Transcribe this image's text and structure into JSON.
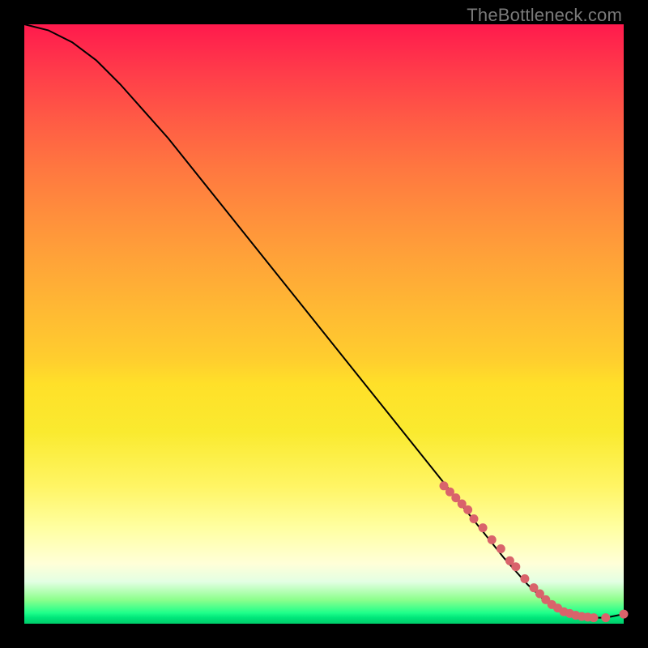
{
  "watermark": "TheBottleneck.com",
  "chart_data": {
    "type": "line",
    "title": "",
    "xlabel": "",
    "ylabel": "",
    "xlim": [
      0,
      100
    ],
    "ylim": [
      0,
      100
    ],
    "grid": false,
    "legend": false,
    "series": [
      {
        "name": "curve",
        "style": "line",
        "color": "#000000",
        "x": [
          0,
          4,
          8,
          12,
          16,
          20,
          24,
          28,
          32,
          36,
          40,
          44,
          48,
          52,
          56,
          60,
          64,
          68,
          72,
          76,
          80,
          84,
          88,
          92,
          95,
          97,
          100
        ],
        "y": [
          100,
          99,
          97,
          94,
          90,
          85.5,
          81,
          76,
          71,
          66,
          61,
          56,
          51,
          46,
          41,
          36,
          31,
          26,
          21,
          16,
          11,
          6.5,
          2.8,
          1.2,
          1.0,
          1.0,
          1.6
        ]
      },
      {
        "name": "highlight-points",
        "style": "scatter",
        "color": "#d9636b",
        "x": [
          70,
          71,
          72,
          73,
          74,
          75,
          76.5,
          78,
          79.5,
          81,
          82,
          83.5,
          85,
          86,
          87,
          88,
          89,
          90,
          91,
          92,
          93,
          94,
          95,
          97,
          100
        ],
        "y": [
          23,
          22,
          21,
          20,
          19,
          17.5,
          16,
          14,
          12.5,
          10.5,
          9.5,
          7.5,
          6,
          5,
          4,
          3.2,
          2.6,
          2.0,
          1.7,
          1.4,
          1.2,
          1.1,
          1.0,
          1.0,
          1.6
        ]
      }
    ]
  }
}
